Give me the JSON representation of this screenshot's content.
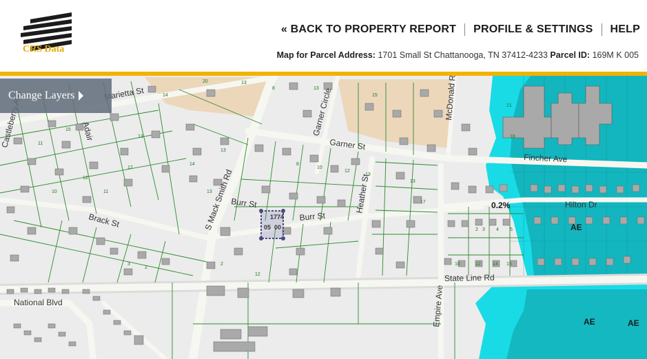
{
  "brand": {
    "name": "CRS Data"
  },
  "nav": {
    "back": "« BACK TO PROPERTY REPORT",
    "profile": "PROFILE & SETTINGS",
    "help": "HELP"
  },
  "parcel": {
    "address_label": "Map for Parcel Address:",
    "address_value": "1701 Small St Chattanooga, TN 37412-4233",
    "id_label": "Parcel ID:",
    "id_value": "169M K  005"
  },
  "map": {
    "layers_button": "Change Layers",
    "streets": {
      "marietta": "Marietta St",
      "adair": "Adair",
      "castleberry": "Castleberry Ave",
      "garner_circle": "Garner Circle",
      "mcdonald": "McDonald Rd",
      "garner": "Garner St",
      "fincher": "Fincher Ave",
      "mack_smith": "S Mack Smith Rd",
      "burr1": "Burr St",
      "burr2": "Burr St",
      "heather": "Heather St",
      "hilton": "Hilton Dr",
      "brack": "Brack St",
      "state_line": "State Line Rd",
      "national": "National Blvd",
      "empire": "Empire Ave"
    },
    "flood": {
      "zone_ae1": "AE",
      "zone_ae2": "AE",
      "zone_ae3": "AE",
      "pct": "0.2%"
    },
    "selected_parcel_labels": [
      "1774",
      "05",
      "00"
    ],
    "colors": {
      "flood_cyan": "#19dbe6",
      "flood_deep": "#11a9b0",
      "road": "#f5f5f0",
      "parcel_line": "#2e8b2e",
      "building": "#a9a9a9",
      "tan_lot": "#ecd6b8",
      "brand_yellow": "#f0b400"
    }
  }
}
